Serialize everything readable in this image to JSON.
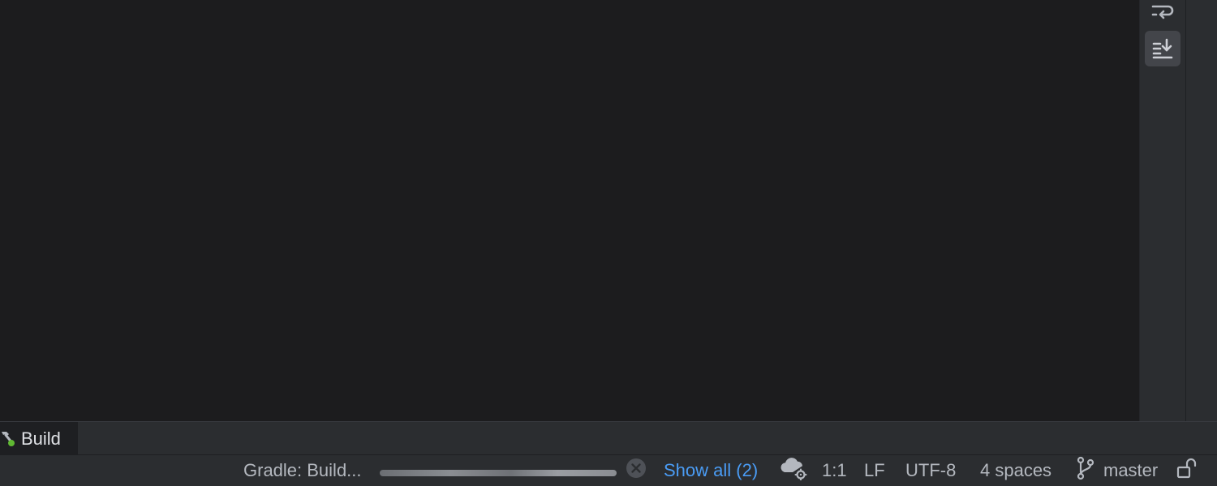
{
  "console_toolbar": {
    "soft_wrap_icon": "soft-wrap-icon",
    "scroll_to_end_icon": "scroll-to-end-icon",
    "scroll_to_end_active": true
  },
  "tool_tabs": {
    "build": {
      "label": "Build",
      "icon": "hammer-icon",
      "status_dot_color": "#5fb832"
    }
  },
  "status_bar": {
    "task_label": "Gradle: Build...",
    "cancel_icon": "cancel-circle-icon",
    "show_all_label": "Show all (2)",
    "daemon_icon": "cloud-gear-icon",
    "caret_position": "1:1",
    "line_separator": "LF",
    "encoding": "UTF-8",
    "indent": "4 spaces",
    "branch_icon": "git-branch-icon",
    "branch": "master",
    "lock_icon": "unlock-icon"
  },
  "colors": {
    "editor_bg": "#1c1c1e",
    "panel_bg": "#2b2d30",
    "link": "#4a9cf5",
    "text": "#b4b8bf"
  }
}
